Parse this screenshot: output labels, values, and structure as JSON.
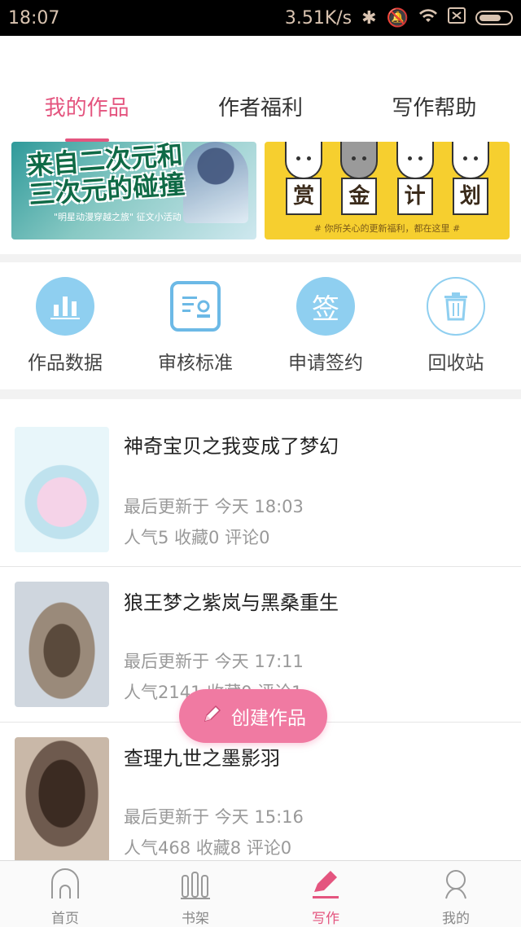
{
  "status_bar": {
    "time": "18:07",
    "net_speed": "3.51K/s",
    "icons": [
      "bluetooth-icon",
      "mute-icon",
      "wifi-icon",
      "sim-icon",
      "battery-icon"
    ]
  },
  "tabs": [
    {
      "label": "我的作品",
      "active": true
    },
    {
      "label": "作者福利",
      "active": false
    },
    {
      "label": "写作帮助",
      "active": false
    }
  ],
  "banners": {
    "left": {
      "headline": "来自二次元和三次元的碰撞",
      "caption": "\"明星动漫穿越之旅\" 征文小活动"
    },
    "right": {
      "signs": [
        "赏",
        "金",
        "计",
        "划"
      ],
      "caption": "# 你所关心的更新福利，都在这里 #"
    }
  },
  "actions": [
    {
      "label": "作品数据",
      "icon": "bar-chart-icon"
    },
    {
      "label": "审核标准",
      "icon": "review-document-icon"
    },
    {
      "label": "申请签约",
      "icon": "sign-icon",
      "icon_text": "签"
    },
    {
      "label": "回收站",
      "icon": "trash-icon"
    }
  ],
  "works": [
    {
      "title": "神奇宝贝之我变成了梦幻",
      "updated": "最后更新于 今天 18:03",
      "stats": "人气5  收藏0  评论0"
    },
    {
      "title": "狼王梦之紫岚与黑桑重生",
      "updated": "最后更新于 今天 17:11",
      "stats": "人气2141  收藏0  评论1"
    },
    {
      "title": "查理九世之墨影羽",
      "updated": "最后更新于 今天 15:16",
      "stats": "人气468  收藏8  评论0"
    }
  ],
  "fab": {
    "label": "创建作品"
  },
  "bottom_nav": [
    {
      "label": "首页",
      "icon": "home-icon",
      "active": false
    },
    {
      "label": "书架",
      "icon": "bookshelf-icon",
      "active": false
    },
    {
      "label": "写作",
      "icon": "pen-icon",
      "active": true
    },
    {
      "label": "我的",
      "icon": "profile-icon",
      "active": false
    }
  ],
  "colors": {
    "accent": "#e4557f",
    "fab": "#f07aa2",
    "icon_blue": "#8fcff0"
  }
}
